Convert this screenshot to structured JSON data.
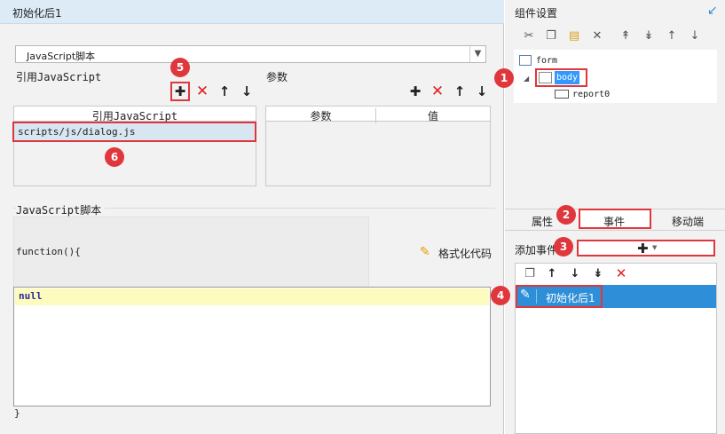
{
  "left": {
    "title": "初始化后1",
    "script_type": "JavaScript脚本",
    "ref_section_label": "引用JavaScript",
    "params_section_label": "参数",
    "ref_table_header": "引用JavaScript",
    "ref_table_rows": [
      "scripts/js/dialog.js"
    ],
    "param_header_name": "参数",
    "param_header_value": "值",
    "script_section_label": "JavaScript脚本",
    "function_text": "function(){",
    "format_button": "格式化代码",
    "code_text": "null",
    "closing_brace": "}"
  },
  "right": {
    "title": "组件设置",
    "tree": {
      "root": "form",
      "selected": "body",
      "child": "report0"
    },
    "tabs": [
      "属性",
      "事件",
      "移动端"
    ],
    "add_event_label": "添加事件",
    "event_item": "初始化后1"
  },
  "badges": [
    "1",
    "2",
    "3",
    "4",
    "5",
    "6"
  ],
  "colors": {
    "accent": "#2e8fd8",
    "highlight_border": "#e0373d",
    "title_bar": "#dcebf5",
    "code_highlight": "#fdfbbd"
  }
}
